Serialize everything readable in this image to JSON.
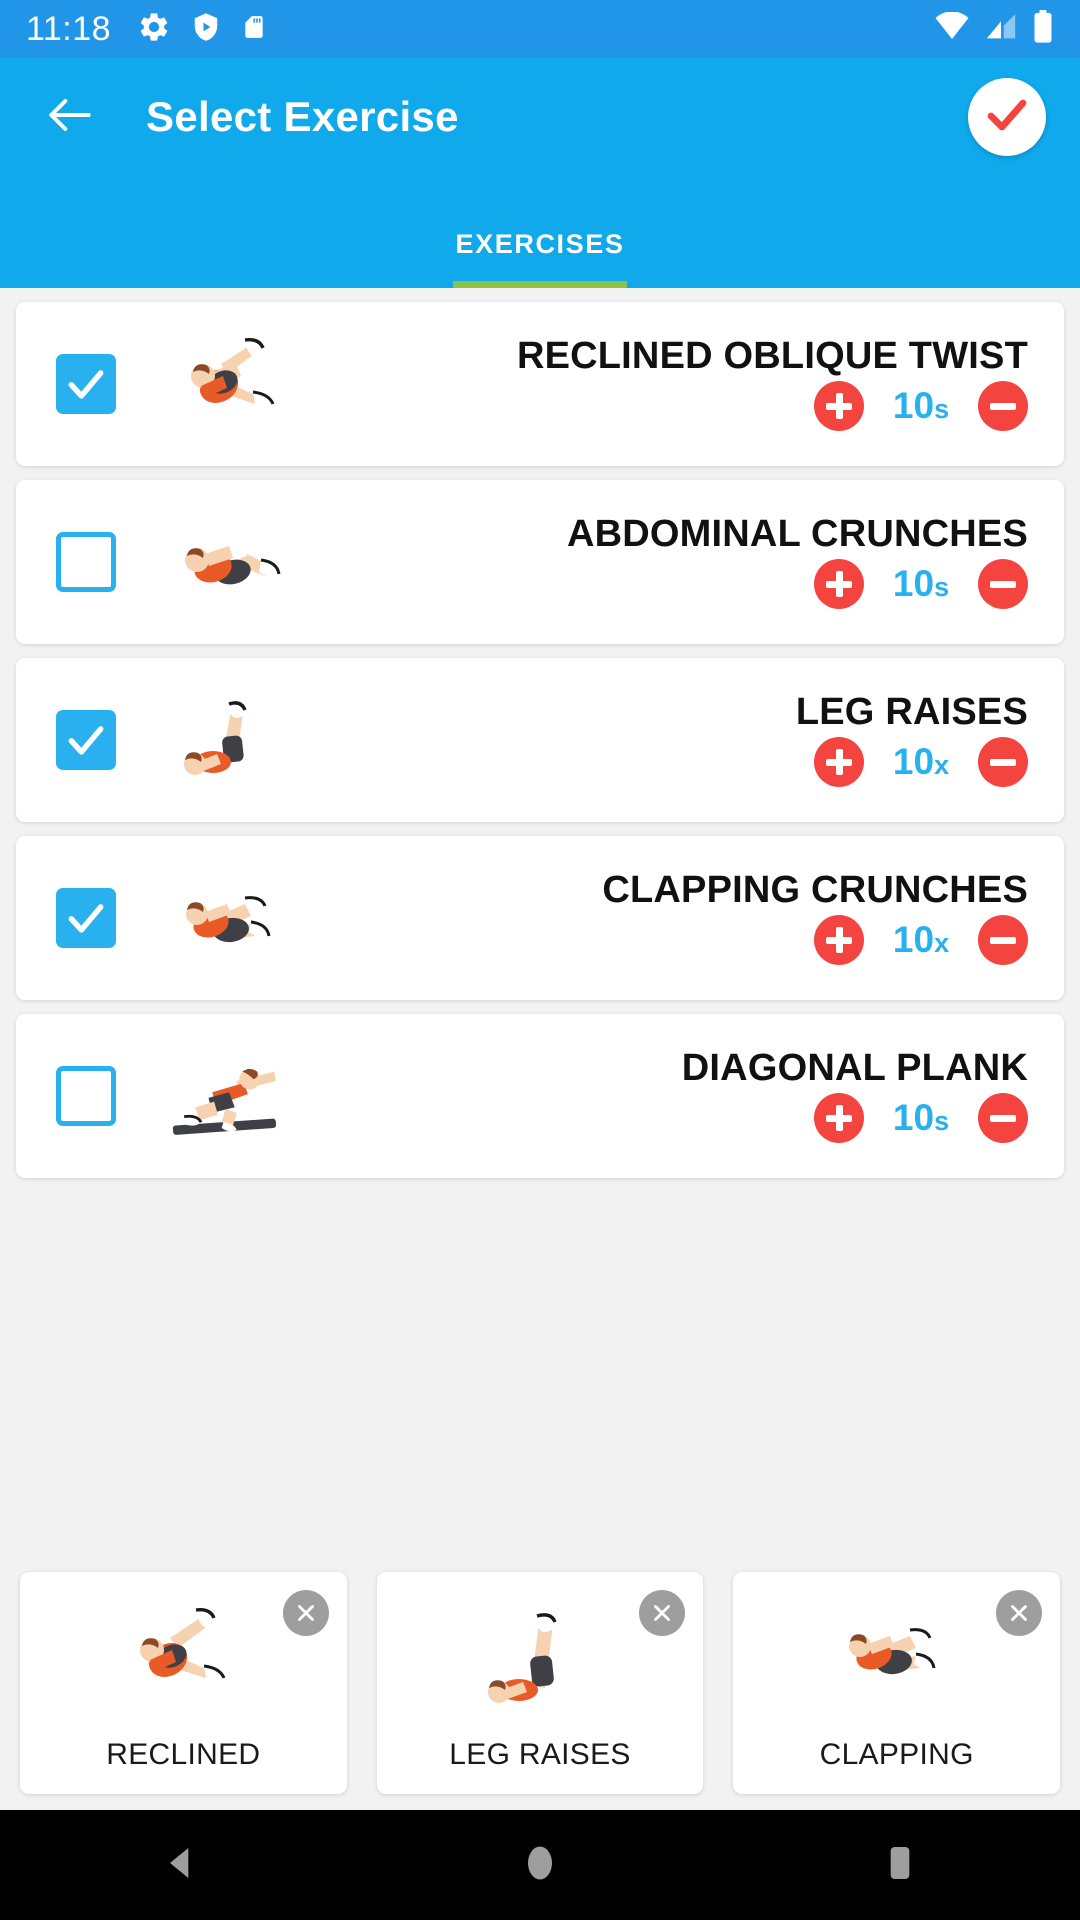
{
  "status_bar": {
    "time": "11:18",
    "left_icons": [
      "gear-icon",
      "shield-play-icon",
      "sd-card-icon"
    ],
    "right_icons": [
      "wifi-icon",
      "cell-signal-icon",
      "battery-icon"
    ],
    "background": "#2196e8"
  },
  "app_bar": {
    "back_label": "back-arrow",
    "title": "Select Exercise",
    "confirm_label": "confirm-check",
    "background": "#0fa9ec",
    "accent_underline": "#8bc34a",
    "tabs": [
      {
        "label": "EXERCISES",
        "active": true
      }
    ]
  },
  "colors": {
    "accent_blue": "#29b0ef",
    "red_button": "#f4443f",
    "green_tab": "#8bc34a",
    "grey_close": "#9e9e9e"
  },
  "exercises": [
    {
      "name": "RECLINED OBLIQUE TWIST",
      "checked": true,
      "count": "10",
      "unit": "s",
      "pose": "reclined-oblique-twist"
    },
    {
      "name": "ABDOMINAL CRUNCHES",
      "checked": false,
      "count": "10",
      "unit": "s",
      "pose": "abdominal-crunches"
    },
    {
      "name": "LEG RAISES",
      "checked": true,
      "count": "10",
      "unit": "x",
      "pose": "leg-raises"
    },
    {
      "name": "CLAPPING CRUNCHES",
      "checked": true,
      "count": "10",
      "unit": "x",
      "pose": "clapping-crunches"
    },
    {
      "name": "DIAGONAL PLANK",
      "checked": false,
      "count": "10",
      "unit": "s",
      "pose": "diagonal-plank"
    }
  ],
  "selected_strip": [
    {
      "label": "RECLINED",
      "pose": "reclined-oblique-twist"
    },
    {
      "label": "LEG RAISES",
      "pose": "leg-raises"
    },
    {
      "label": "CLAPPING",
      "pose": "clapping-crunches"
    }
  ],
  "nav_bar": {
    "buttons": [
      "back-triangle-icon",
      "home-circle-icon",
      "recents-square-icon"
    ]
  }
}
